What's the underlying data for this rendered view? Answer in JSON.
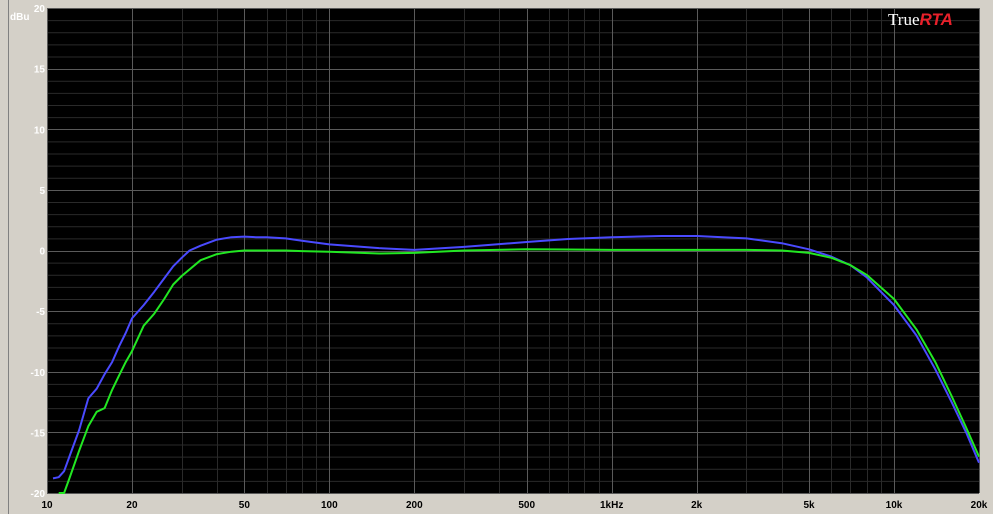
{
  "app": {
    "logo": {
      "part1": "True",
      "part2": "RTA"
    }
  },
  "chart_data": {
    "type": "line",
    "ylabel": "dBu",
    "x_scale": "log",
    "xlim": [
      10,
      20000
    ],
    "ylim": [
      -20,
      20
    ],
    "grid": true,
    "y_ticks": [
      {
        "value": 20,
        "label": "20"
      },
      {
        "value": 15,
        "label": "15"
      },
      {
        "value": 10,
        "label": "10"
      },
      {
        "value": 5,
        "label": "5"
      },
      {
        "value": 0,
        "label": "0"
      },
      {
        "value": -5,
        "label": "-5"
      },
      {
        "value": -10,
        "label": "-10"
      },
      {
        "value": -15,
        "label": "-15"
      },
      {
        "value": -20,
        "label": "-20"
      }
    ],
    "x_ticks": [
      {
        "value": 10,
        "label": "10"
      },
      {
        "value": 20,
        "label": "20"
      },
      {
        "value": 50,
        "label": "50"
      },
      {
        "value": 100,
        "label": "100"
      },
      {
        "value": 200,
        "label": "200"
      },
      {
        "value": 500,
        "label": "500"
      },
      {
        "value": 1000,
        "label": "1kHz"
      },
      {
        "value": 2000,
        "label": "2k"
      },
      {
        "value": 5000,
        "label": "5k"
      },
      {
        "value": 10000,
        "label": "10k"
      },
      {
        "value": 20000,
        "label": "20k"
      }
    ],
    "colors": {
      "background": "#000000",
      "grid_major": "#5a5a5a",
      "grid_minor": "#2a2a2a"
    },
    "series": [
      {
        "color": "#4a4aff",
        "points": [
          [
            10.5,
            -18.8
          ],
          [
            11,
            -18.7
          ],
          [
            11.5,
            -18.2
          ],
          [
            12,
            -17
          ],
          [
            13,
            -14.8
          ],
          [
            14,
            -12.2
          ],
          [
            15,
            -11.4
          ],
          [
            16,
            -10.2
          ],
          [
            17,
            -9.2
          ],
          [
            18,
            -7.9
          ],
          [
            19,
            -6.8
          ],
          [
            20,
            -5.6
          ],
          [
            22,
            -4.5
          ],
          [
            24,
            -3.4
          ],
          [
            26,
            -2.3
          ],
          [
            28,
            -1.3
          ],
          [
            30,
            -0.6
          ],
          [
            32,
            0
          ],
          [
            35,
            0.4
          ],
          [
            40,
            0.9
          ],
          [
            45,
            1.1
          ],
          [
            50,
            1.15
          ],
          [
            55,
            1.1
          ],
          [
            60,
            1.1
          ],
          [
            70,
            1.0
          ],
          [
            80,
            0.8
          ],
          [
            100,
            0.5
          ],
          [
            150,
            0.2
          ],
          [
            200,
            0.05
          ],
          [
            300,
            0.3
          ],
          [
            500,
            0.7
          ],
          [
            700,
            0.95
          ],
          [
            1000,
            1.1
          ],
          [
            1500,
            1.2
          ],
          [
            2000,
            1.2
          ],
          [
            3000,
            1.0
          ],
          [
            4000,
            0.6
          ],
          [
            5000,
            0.1
          ],
          [
            6000,
            -0.5
          ],
          [
            7000,
            -1.2
          ],
          [
            8000,
            -2.2
          ],
          [
            10000,
            -4.5
          ],
          [
            12000,
            -7
          ],
          [
            14000,
            -9.8
          ],
          [
            16000,
            -12.5
          ],
          [
            18000,
            -15
          ],
          [
            20000,
            -17.5
          ]
        ]
      },
      {
        "color": "#22e822",
        "points": [
          [
            11,
            -20
          ],
          [
            11.5,
            -20
          ],
          [
            12,
            -18.8
          ],
          [
            13,
            -16.5
          ],
          [
            14,
            -14.5
          ],
          [
            15,
            -13.3
          ],
          [
            16,
            -13
          ],
          [
            17,
            -11.5
          ],
          [
            18,
            -10.3
          ],
          [
            19,
            -9.2
          ],
          [
            20,
            -8.3
          ],
          [
            22,
            -6.2
          ],
          [
            24,
            -5.2
          ],
          [
            26,
            -4
          ],
          [
            28,
            -2.8
          ],
          [
            30,
            -2.1
          ],
          [
            35,
            -0.8
          ],
          [
            40,
            -0.3
          ],
          [
            45,
            -0.1
          ],
          [
            50,
            0
          ],
          [
            60,
            0
          ],
          [
            70,
            0
          ],
          [
            80,
            -0.05
          ],
          [
            100,
            -0.1
          ],
          [
            150,
            -0.25
          ],
          [
            200,
            -0.2
          ],
          [
            300,
            0
          ],
          [
            500,
            0.1
          ],
          [
            700,
            0.08
          ],
          [
            1000,
            0.05
          ],
          [
            2000,
            0.05
          ],
          [
            3000,
            0.05
          ],
          [
            4000,
            0
          ],
          [
            5000,
            -0.2
          ],
          [
            6000,
            -0.6
          ],
          [
            7000,
            -1.2
          ],
          [
            8000,
            -2.0
          ],
          [
            10000,
            -4.0
          ],
          [
            12000,
            -6.5
          ],
          [
            14000,
            -9.2
          ],
          [
            16000,
            -12
          ],
          [
            18000,
            -14.6
          ],
          [
            20000,
            -17
          ]
        ]
      }
    ]
  }
}
